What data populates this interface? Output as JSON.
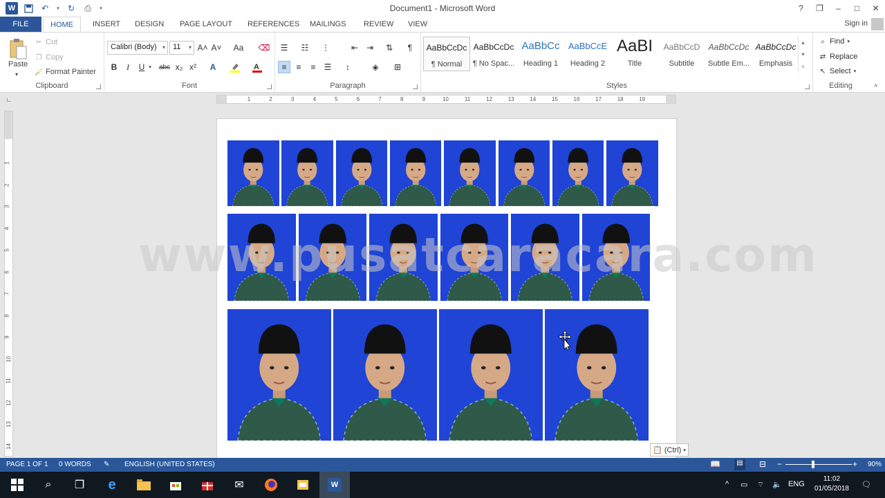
{
  "window": {
    "title": "Document1 - Microsoft Word",
    "help": "?",
    "controls": [
      "❐",
      "–",
      "□",
      "✕"
    ]
  },
  "tabs": {
    "file": "FILE",
    "items": [
      "HOME",
      "INSERT",
      "DESIGN",
      "PAGE LAYOUT",
      "REFERENCES",
      "MAILINGS",
      "REVIEW",
      "VIEW"
    ],
    "signin": "Sign in"
  },
  "clipboard": {
    "paste": "Paste",
    "cut": "Cut",
    "copy": "Copy",
    "format_painter": "Format Painter",
    "label": "Clipboard"
  },
  "font": {
    "name": "Calibri (Body)",
    "size": "11",
    "label": "Font",
    "grow": "A˄",
    "shrink": "A˅",
    "case": "Aa",
    "bold": "B",
    "italic": "I",
    "underline": "U",
    "strike": "abc",
    "sub": "x₂",
    "sup": "x²"
  },
  "paragraph": {
    "label": "Paragraph",
    "pilcrow": "¶"
  },
  "styles": {
    "label": "Styles",
    "items": [
      {
        "sample": "AaBbCcDc",
        "name": "¶ Normal"
      },
      {
        "sample": "AaBbCcDc",
        "name": "¶ No Spac..."
      },
      {
        "sample": "AaBbCc",
        "name": "Heading 1"
      },
      {
        "sample": "AaBbCcE",
        "name": "Heading 2"
      },
      {
        "sample": "AaBI",
        "name": "Title"
      },
      {
        "sample": "AaBbCcD",
        "name": "Subtitle"
      },
      {
        "sample": "AaBbCcDc",
        "name": "Subtle Em..."
      },
      {
        "sample": "AaBbCcDc",
        "name": "Emphasis"
      }
    ]
  },
  "editing": {
    "label": "Editing",
    "find": "Find",
    "replace": "Replace",
    "select": "Select"
  },
  "ruler": {
    "ticks": [
      "1",
      "2",
      "3",
      "4",
      "5",
      "6",
      "7",
      "8",
      "9",
      "10",
      "11",
      "12",
      "13",
      "14",
      "15",
      "16",
      "17",
      "18",
      "19"
    ],
    "vticks": [
      "1",
      "2",
      "3",
      "4",
      "5",
      "6",
      "7",
      "8",
      "9",
      "10",
      "11",
      "12",
      "13",
      "14"
    ]
  },
  "document": {
    "watermark": "www.pusatcaracara.com",
    "paste_options": "(Ctrl)"
  },
  "status": {
    "page": "PAGE 1 OF 1",
    "words": "0 WORDS",
    "language": "ENGLISH (UNITED STATES)",
    "zoom": "90%",
    "zoom_level": 0.9
  },
  "taskbar": {
    "lang": "ENG",
    "time": "11:02",
    "date": "01/05/2018"
  },
  "colors": {
    "word_blue": "#2b579a",
    "photo_bg": "#1f44d6",
    "highlight": "#ffff00",
    "font_color": "#e00000"
  }
}
